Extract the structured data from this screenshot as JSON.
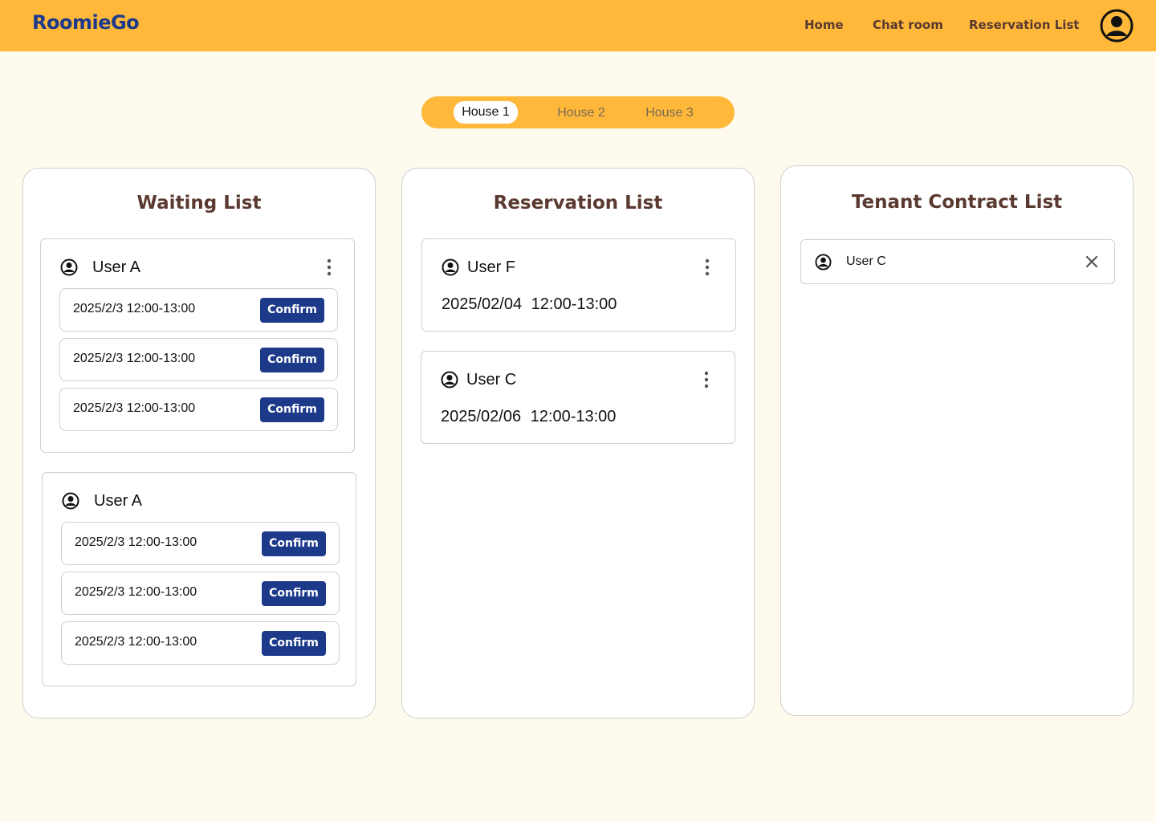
{
  "nav": {
    "logo": "RoomieGo",
    "links": [
      "Home",
      "Chat room",
      "Reservation List"
    ],
    "profile_icon": "account-circle-icon"
  },
  "tabs": {
    "items": [
      "House 1",
      "House 2",
      "House 3"
    ],
    "selected": "House 1"
  },
  "waiting_list": {
    "title": "Waiting List",
    "groups": [
      {
        "user": "User A",
        "has_menu": true,
        "slots": [
          {
            "time": "2025/2/3 12:00-13:00",
            "action": "Confirm"
          },
          {
            "time": "2025/2/3 12:00-13:00",
            "action": "Confirm"
          },
          {
            "time": "2025/2/3 12:00-13:00",
            "action": "Confirm"
          }
        ]
      },
      {
        "user": "User A",
        "has_menu": false,
        "slots": [
          {
            "time": "2025/2/3 12:00-13:00",
            "action": "Confirm"
          },
          {
            "time": "2025/2/3 12:00-13:00",
            "action": "Confirm"
          },
          {
            "time": "2025/2/3 12:00-13:00",
            "action": "Confirm"
          }
        ]
      }
    ]
  },
  "reservation_list": {
    "title": "Reservation List",
    "items": [
      {
        "user": "User F",
        "date": "2025/02/04",
        "time": "12:00-13:00"
      },
      {
        "user": "User C",
        "date": "2025/02/06",
        "time": "12:00-13:00"
      }
    ]
  },
  "tenant_contract_list": {
    "title": "Tenant Contract List",
    "items": [
      {
        "user": "User C"
      }
    ]
  },
  "colors": {
    "accent": "#FFB83A",
    "background": "#FFFAEE",
    "primary_button": "#1D3A8A",
    "heading": "#5A3A30"
  }
}
